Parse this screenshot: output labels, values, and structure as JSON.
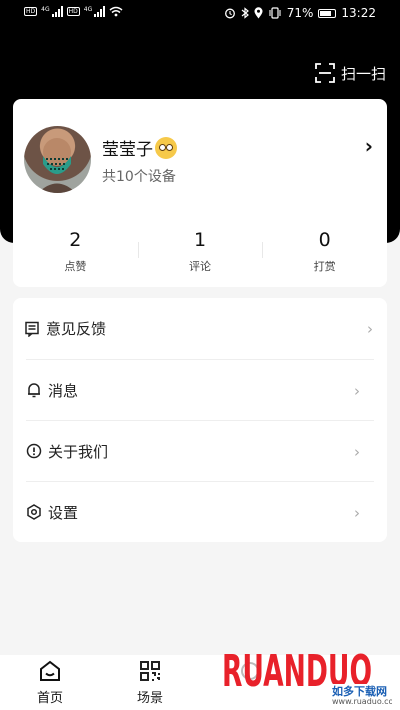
{
  "status_bar": {
    "network_left": "4G",
    "network_right": "4G",
    "battery": "71%",
    "time": "13:22"
  },
  "header": {
    "scan_label": "扫一扫"
  },
  "profile": {
    "username": "莹莹子",
    "device_count": "共10个设备",
    "stats": [
      {
        "value": "2",
        "label": "点赞"
      },
      {
        "value": "1",
        "label": "评论"
      },
      {
        "value": "0",
        "label": "打赏"
      }
    ]
  },
  "menu": {
    "items": [
      {
        "label": "意见反馈",
        "icon": "feedback-icon"
      },
      {
        "label": "消息",
        "icon": "bell-icon"
      },
      {
        "label": "关于我们",
        "icon": "info-icon"
      },
      {
        "label": "设置",
        "icon": "settings-icon"
      }
    ]
  },
  "tab_bar": {
    "tabs": [
      {
        "label": "首页",
        "icon": "home-icon"
      },
      {
        "label": "场景",
        "icon": "scene-grid-icon"
      }
    ]
  },
  "watermark": {
    "logo_text": "RUANDUO",
    "sub_text": "如多下载网",
    "url": "www.ruaduo.com"
  }
}
